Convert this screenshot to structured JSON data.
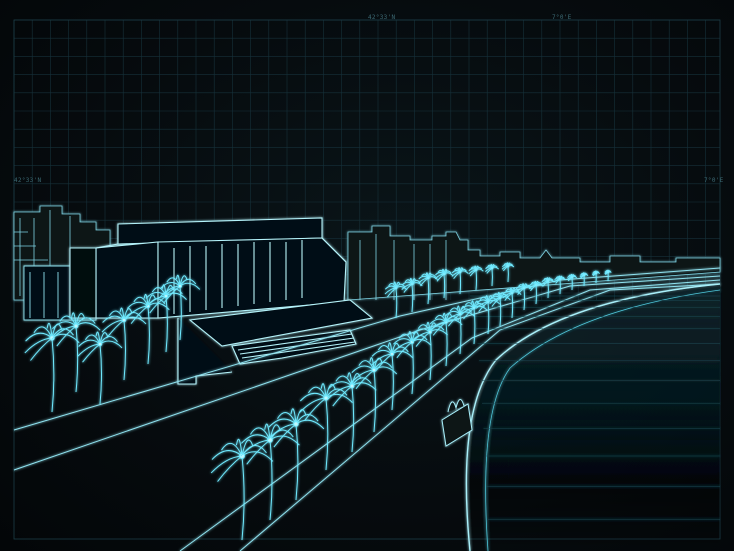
{
  "coordinates": {
    "top_1": "42°33'N",
    "top_2": "7°0'E",
    "left": "42°33'N",
    "right": "7°0'E"
  },
  "colors": {
    "background": "#050a0d",
    "grid": "#16313a",
    "line": "#9fe9f5",
    "glow": "#35d8f0",
    "palm": "#6feaff"
  }
}
